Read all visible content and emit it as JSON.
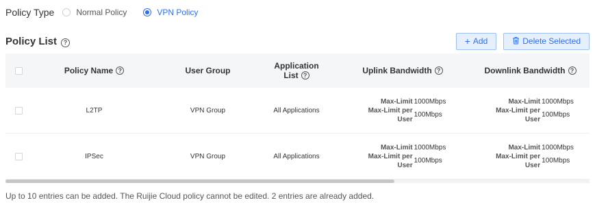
{
  "policy_type": {
    "label": "Policy Type",
    "options": [
      {
        "label": "Normal Policy",
        "selected": false
      },
      {
        "label": "VPN Policy",
        "selected": true
      }
    ]
  },
  "policy_list": {
    "title": "Policy List",
    "add_label": "Add",
    "delete_label": "Delete Selected"
  },
  "table": {
    "columns": {
      "policy_name": "Policy Name",
      "user_group": "User Group",
      "application_list_line1": "Application",
      "application_list_line2": "List",
      "uplink": "Uplink Bandwidth",
      "downlink": "Downlink Bandwidth"
    },
    "bandwidth_labels": {
      "max_limit": "Max-Limit",
      "max_limit_per_1": "Max-Limit per",
      "max_limit_per_2": "User"
    },
    "rows": [
      {
        "policy_name": "L2TP",
        "user_group": "VPN Group",
        "application_list": "All Applications",
        "uplink_max": "1000Mbps",
        "uplink_per_user": "100Mbps",
        "downlink_max": "1000Mbps",
        "downlink_per_user": "100Mbps"
      },
      {
        "policy_name": "IPSec",
        "user_group": "VPN Group",
        "application_list": "All Applications",
        "uplink_max": "1000Mbps",
        "uplink_per_user": "100Mbps",
        "downlink_max": "1000Mbps",
        "downlink_per_user": "100Mbps"
      }
    ]
  },
  "footer": {
    "note": "Up to 10 entries can be added. The Ruijie Cloud policy cannot be edited. 2 entries are already added."
  },
  "colors": {
    "accent": "#2f6fea",
    "header_bg": "#f5f6f8",
    "button_bg": "#e6f0fd"
  }
}
